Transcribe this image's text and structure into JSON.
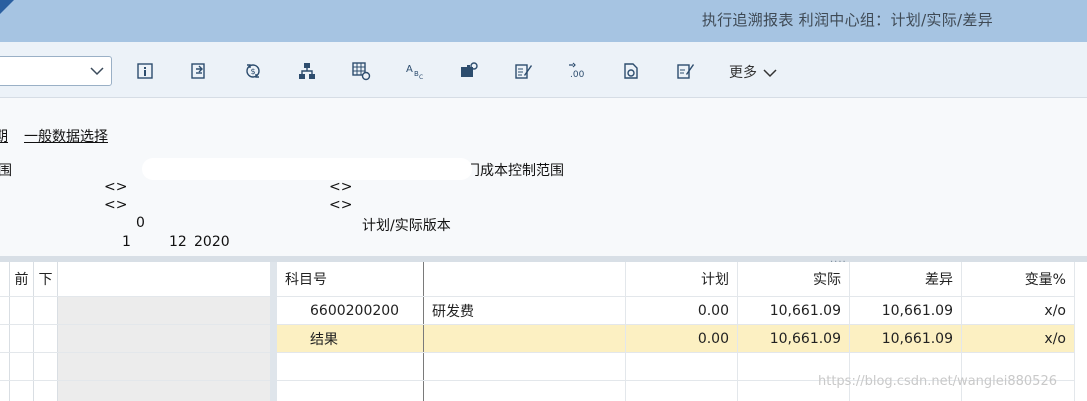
{
  "window": {
    "title": "执行追溯报表 利润中心组：计划/实际/差异"
  },
  "toolbar": {
    "combo_value": "",
    "icons": [
      "info-icon",
      "export-icon",
      "currency-icon",
      "hierarchy-icon",
      "layout-settings-icon",
      "text-format-icon",
      "puzzle-settings-icon",
      "edit-list-icon",
      "decimal-icon",
      "refresh-doc-icon",
      "edit-doc-icon"
    ],
    "more_label": "更多"
  },
  "header": {
    "tab_period": "期",
    "tab_general_data": "一般数据选择",
    "range_label": "围",
    "range_desc_tail": "门成本控制范围",
    "ref1_left": "<>",
    "ref1_right": "<>",
    "ref2_left": "<>",
    "ref2_right": "<>",
    "version_value": "0",
    "version_label": "计划/实际版本",
    "period_from": "1",
    "period_to": "12",
    "year": "2020"
  },
  "left_tree": {
    "col_prev": "前",
    "col_next": "下"
  },
  "grid": {
    "columns": [
      "科目号",
      "",
      "计划",
      "实际",
      "差异",
      "变量%"
    ],
    "rows": [
      {
        "account": "6600200200",
        "name": "研发费",
        "plan": "0.00",
        "actual": "10,661.09",
        "diff": "10,661.09",
        "var": "x/o"
      },
      {
        "account": "结果",
        "name": "",
        "plan": "0.00",
        "actual": "10,661.09",
        "diff": "10,661.09",
        "var": "x/o"
      }
    ]
  },
  "watermark": "https://blog.csdn.net/wanglei880526"
}
